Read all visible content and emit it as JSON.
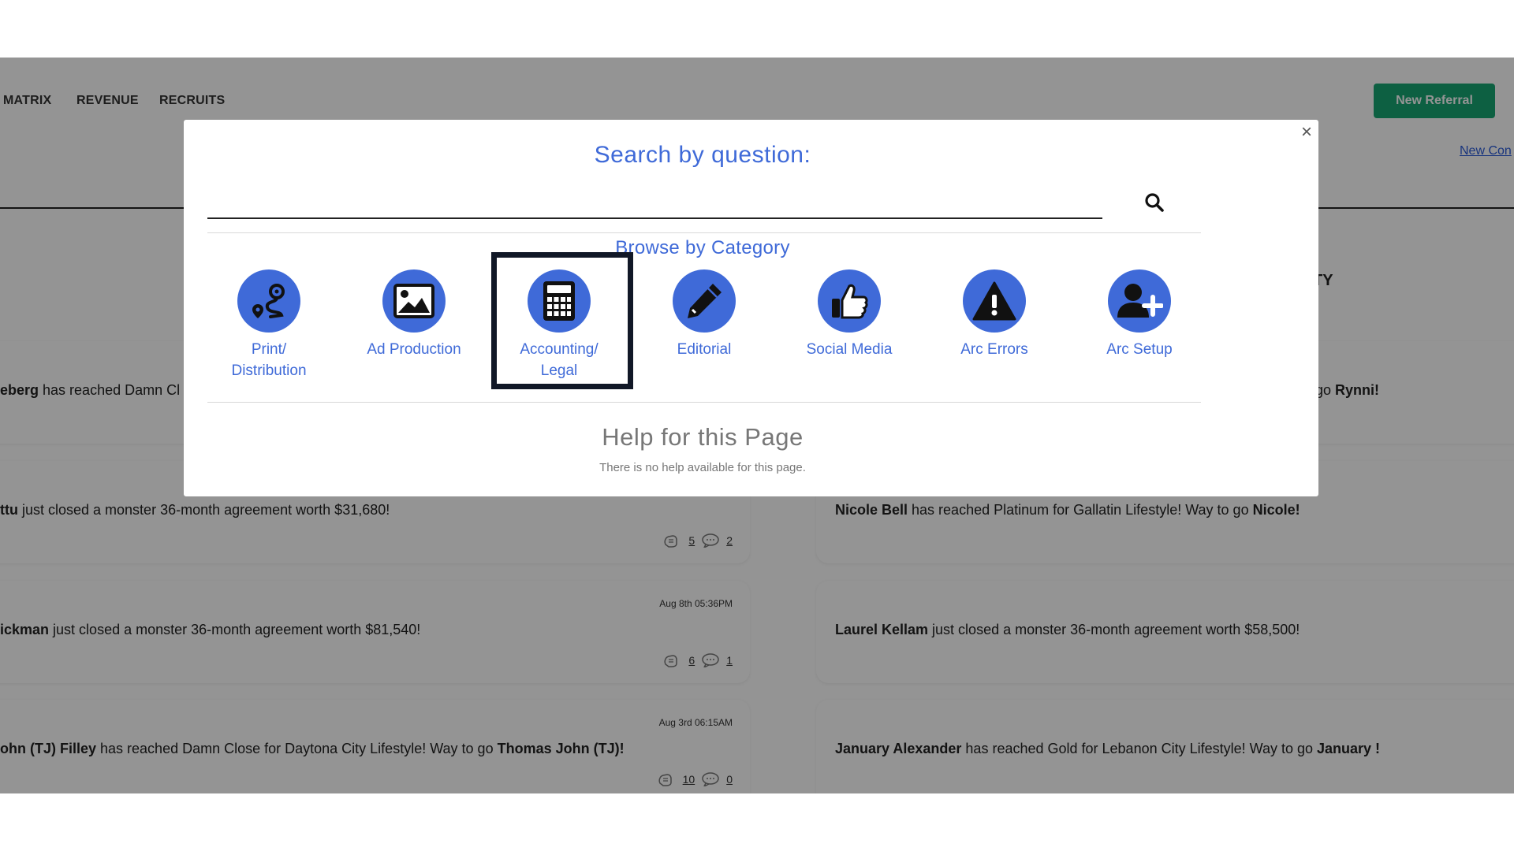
{
  "nav": {
    "items": [
      "MATRIX",
      "REVENUE",
      "RECRUITS"
    ],
    "new_referral": "New Referral",
    "new_contact_link": "New Con"
  },
  "right_panel": {
    "title_fragment": "TY"
  },
  "feed_left": [
    {
      "name": "eberg",
      "text": " has reached Damn Cl",
      "date": "",
      "likes": "",
      "comments": ""
    },
    {
      "name": "ttu",
      "text": " just closed a monster 36-month agreement worth $31,680!",
      "date": "",
      "likes": "5",
      "comments": "2"
    },
    {
      "name": "ickman",
      "text": " just closed a monster 36-month agreement worth $81,540!",
      "date": "Aug 8th 05:36PM",
      "likes": "6",
      "comments": "1"
    },
    {
      "name": "ohn (TJ) Filley",
      "text": " has reached Damn Close for Daytona City Lifestyle! Way to go ",
      "name2": "Thomas John (TJ)!",
      "date": "Aug 3rd 06:15AM",
      "likes": "10",
      "comments": "0"
    }
  ],
  "feed_right": [
    {
      "text": "go ",
      "name2": "Rynni!"
    },
    {
      "name": "Nicole Bell",
      "text": " has reached Platinum for Gallatin Lifestyle! Way to go ",
      "name2": "Nicole!"
    },
    {
      "name": "Laurel Kellam",
      "text": " just closed a monster 36-month agreement worth $58,500!"
    },
    {
      "name": "January Alexander",
      "text": " has reached Gold for Lebanon City Lifestyle! Way to go ",
      "name2": "January !"
    }
  ],
  "modal": {
    "close": "×",
    "search_title": "Search by question:",
    "search_value": "",
    "search_placeholder": "",
    "browse_title": "Browse by Category",
    "categories": [
      {
        "label": "Print/\nDistribution",
        "icon": "route-icon"
      },
      {
        "label": "Ad Production",
        "icon": "image-icon"
      },
      {
        "label": "Accounting/\nLegal",
        "icon": "calculator-icon"
      },
      {
        "label": "Editorial",
        "icon": "pencil-icon"
      },
      {
        "label": "Social Media",
        "icon": "thumbs-up-icon"
      },
      {
        "label": "Arc Errors",
        "icon": "warning-icon"
      },
      {
        "label": "Arc Setup",
        "icon": "user-plus-icon"
      }
    ],
    "help_title": "Help for this Page",
    "help_text": "There is no help available for this page."
  },
  "colors": {
    "accent": "#3f6ad8",
    "button_green": "#17a673",
    "highlight_border": "#111827"
  }
}
